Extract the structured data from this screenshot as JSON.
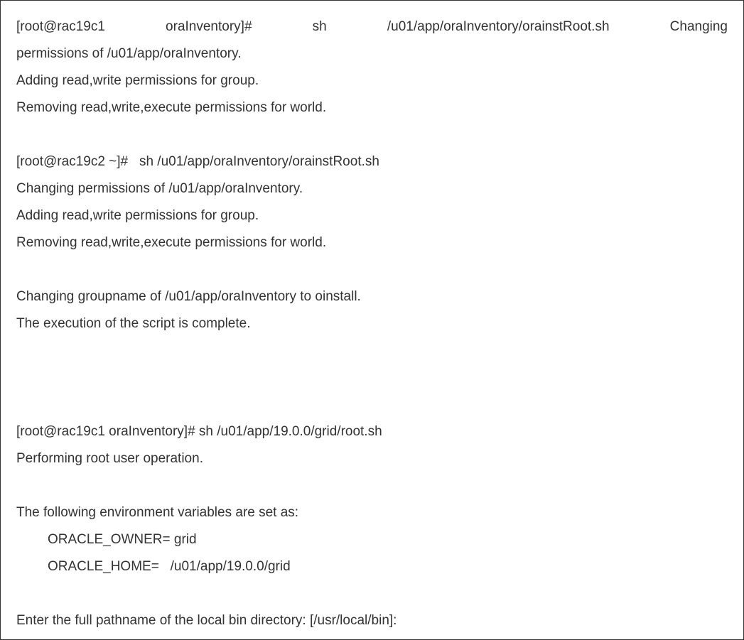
{
  "block1": {
    "cmd_part1": "[root@rac19c1",
    "cmd_part2": "oraInventory]#",
    "cmd_part3": "sh",
    "cmd_part4": "/u01/app/oraInventory/orainstRoot.sh",
    "cmd_part5": "Changing",
    "line2": "permissions of /u01/app/oraInventory.",
    "line3": "Adding read,write permissions for group.",
    "line4": "Removing read,write,execute permissions for world."
  },
  "block2": {
    "line1": "[root@rac19c2 ~]#   sh /u01/app/oraInventory/orainstRoot.sh",
    "line2": "Changing permissions of /u01/app/oraInventory.",
    "line3": "Adding read,write permissions for group.",
    "line4": "Removing read,write,execute permissions for world."
  },
  "block3": {
    "line1": "Changing groupname of /u01/app/oraInventory to oinstall.",
    "line2": "The execution of the script is complete."
  },
  "block4": {
    "line1": "[root@rac19c1 oraInventory]# sh /u01/app/19.0.0/grid/root.sh",
    "line2": "Performing root user operation."
  },
  "block5": {
    "line1": "The following environment variables are set as:",
    "line2": "ORACLE_OWNER= grid",
    "line3": "ORACLE_HOME=   /u01/app/19.0.0/grid"
  },
  "block6": {
    "line1": "Enter the full pathname of the local bin directory: [/usr/local/bin]:"
  }
}
